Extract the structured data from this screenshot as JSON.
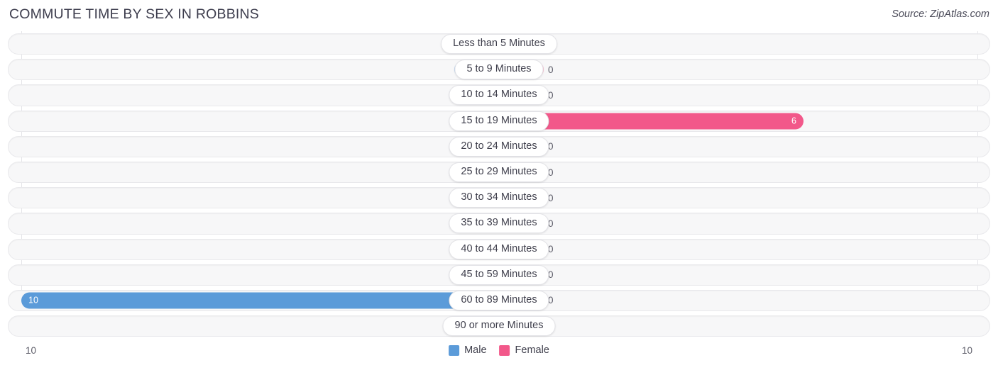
{
  "header": {
    "title": "COMMUTE TIME BY SEX IN ROBBINS",
    "source": "Source: ZipAtlas.com"
  },
  "axis": {
    "left_label": "10",
    "right_label": "10"
  },
  "legend": {
    "items": [
      {
        "label": "Male",
        "color": "#5b9bd9"
      },
      {
        "label": "Female",
        "color": "#f2588a"
      }
    ]
  },
  "colors": {
    "male_light": "#a8c8ec",
    "male_strong": "#5b9bd9",
    "female_light": "#f9a7c1",
    "female_strong": "#f2588a",
    "track": "#f7f7f8",
    "title": "#3d3d4d"
  },
  "chart_data": {
    "type": "bar",
    "title": "COMMUTE TIME BY SEX IN ROBBINS",
    "subtitle": "",
    "xlabel": "",
    "ylabel": "",
    "orientation": "horizontal-diverging",
    "xlim": [
      10,
      10
    ],
    "grid": true,
    "legend_position": "bottom-center",
    "categories": [
      "Less than 5 Minutes",
      "5 to 9 Minutes",
      "10 to 14 Minutes",
      "15 to 19 Minutes",
      "20 to 24 Minutes",
      "25 to 29 Minutes",
      "30 to 34 Minutes",
      "35 to 39 Minutes",
      "40 to 44 Minutes",
      "45 to 59 Minutes",
      "60 to 89 Minutes",
      "90 or more Minutes"
    ],
    "series": [
      {
        "name": "Male",
        "values": [
          0,
          0,
          0,
          0,
          0,
          0,
          0,
          0,
          0,
          0,
          10,
          0
        ]
      },
      {
        "name": "Female",
        "values": [
          0,
          0,
          0,
          6,
          0,
          0,
          0,
          0,
          0,
          0,
          0,
          0
        ]
      }
    ]
  },
  "rows": [
    {
      "label": "Less than 5 Minutes",
      "male": "0",
      "female": "0"
    },
    {
      "label": "5 to 9 Minutes",
      "male": "0",
      "female": "0"
    },
    {
      "label": "10 to 14 Minutes",
      "male": "0",
      "female": "0"
    },
    {
      "label": "15 to 19 Minutes",
      "male": "0",
      "female": "6"
    },
    {
      "label": "20 to 24 Minutes",
      "male": "0",
      "female": "0"
    },
    {
      "label": "25 to 29 Minutes",
      "male": "0",
      "female": "0"
    },
    {
      "label": "30 to 34 Minutes",
      "male": "0",
      "female": "0"
    },
    {
      "label": "35 to 39 Minutes",
      "male": "0",
      "female": "0"
    },
    {
      "label": "40 to 44 Minutes",
      "male": "0",
      "female": "0"
    },
    {
      "label": "45 to 59 Minutes",
      "male": "0",
      "female": "0"
    },
    {
      "label": "60 to 89 Minutes",
      "male": "10",
      "female": "0"
    },
    {
      "label": "90 or more Minutes",
      "male": "0",
      "female": "0"
    }
  ]
}
